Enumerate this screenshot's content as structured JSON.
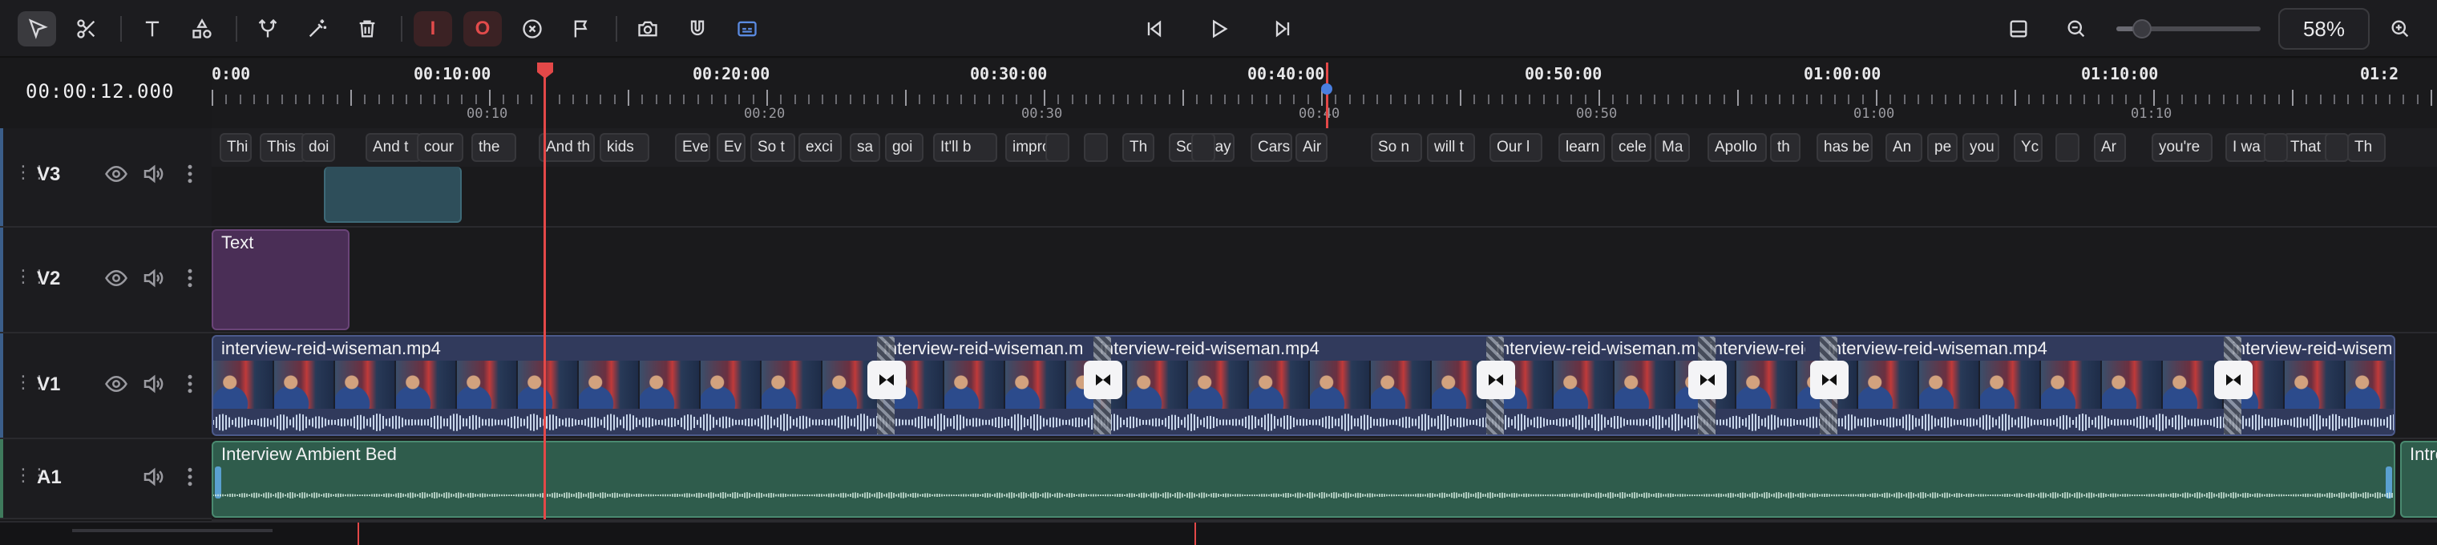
{
  "toolbar": {
    "tools": [
      "select-tool",
      "razor-tool",
      "text-tool",
      "shapes-tool",
      "split-tool",
      "magic-tool",
      "delete-tool"
    ],
    "mark_in_label": "I",
    "mark_out_label": "O",
    "zoom_level": "58%",
    "zoom_fraction": 0.18
  },
  "timecode": "00:00:12.000",
  "ruler": {
    "major": [
      "0:00",
      "00:10:00",
      "00:20:00",
      "00:30:00",
      "00:40:00",
      "00:50:00",
      "01:00:00",
      "01:10:00",
      "01:2"
    ],
    "minor": [
      "00:10",
      "00:20",
      "00:30",
      "00:40",
      "00:50",
      "01:00",
      "01:10"
    ]
  },
  "tracks": {
    "v3": {
      "name": "V3"
    },
    "v2": {
      "name": "V2",
      "clip_label": "Text"
    },
    "v1": {
      "name": "V1"
    },
    "a1": {
      "name": "A1",
      "clip_label": "Interview Ambient Bed",
      "next_clip_label": "Intro"
    }
  },
  "captions": [
    "Thi",
    "This",
    "doi",
    "And t",
    "cour",
    "the",
    "And th",
    "kids",
    "Eve",
    "Ev",
    "So t",
    "exci",
    "sa",
    "goi",
    "It'll b",
    "improv",
    "Th",
    "So I say",
    "Cars",
    "Air",
    "So n",
    "will t",
    "Our l",
    "learn",
    "cele",
    "Ma",
    "Apollo",
    "th",
    "has be",
    "An",
    "pe",
    "you",
    "Yc",
    "Ar",
    "you're",
    "I wa",
    "That",
    "Th"
  ],
  "v1_clips": [
    "interview-reid-wiseman.mp4",
    "interview-reid-wiseman.mp4",
    "interview-reid-wiseman.mp4",
    "interview-reid-wiseman.mp4",
    "interview-reid-wiseman.mp4",
    "interview-reid-wiseman.mp4",
    "interview-reid-wiseman.mp4"
  ]
}
